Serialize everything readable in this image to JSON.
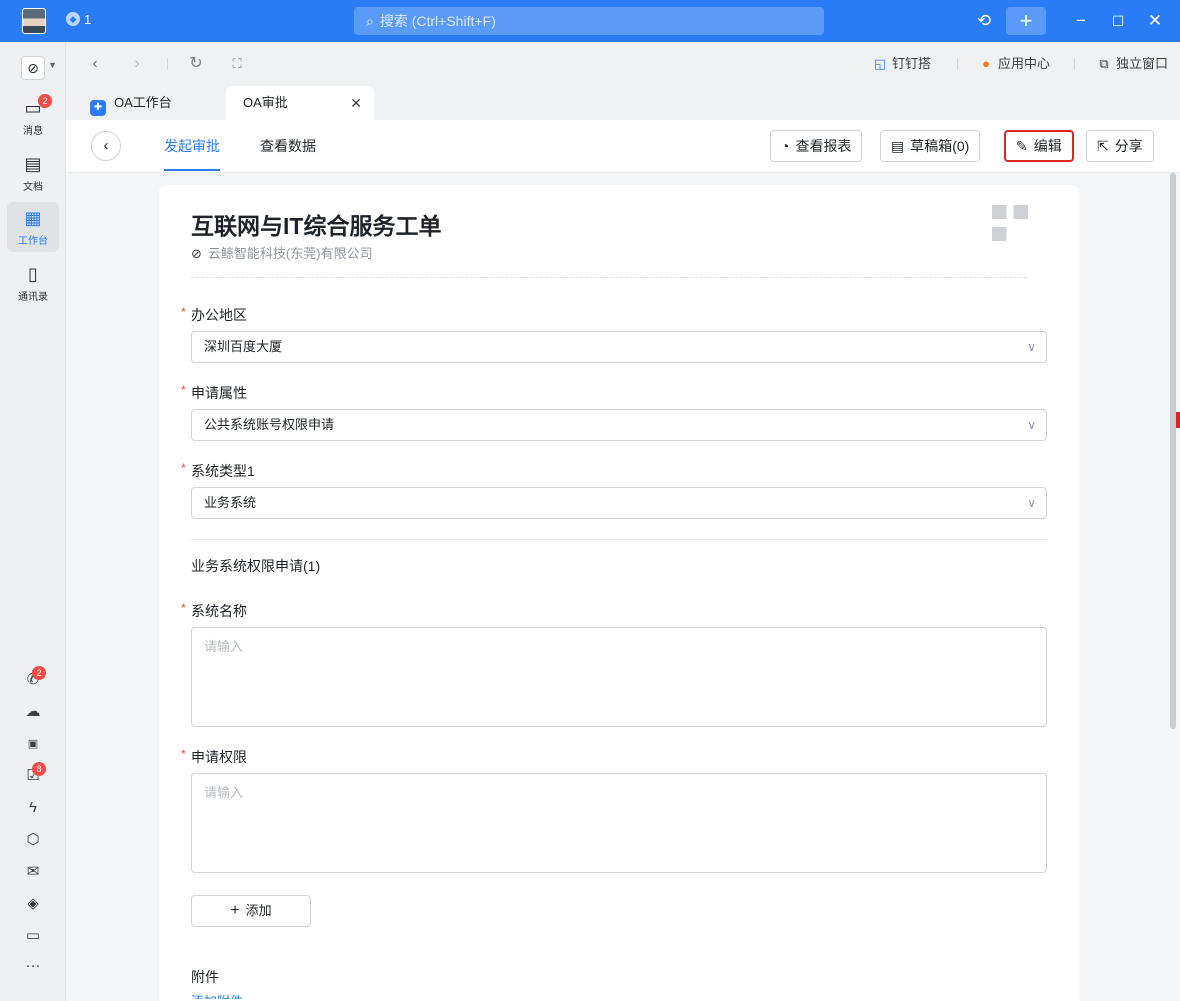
{
  "titlebar": {
    "count": "1",
    "search_placeholder": "搜索 (Ctrl+Shift+F)"
  },
  "nav": {
    "items": [
      {
        "label": "消息",
        "badge": "2"
      },
      {
        "label": "文档"
      },
      {
        "label": "工作台"
      },
      {
        "label": "通讯录"
      }
    ],
    "tool_badges": {
      "calls": "2",
      "todo": "8"
    }
  },
  "browserbar": {
    "links": [
      "钉钉搭",
      "应用中心",
      "独立窗口"
    ]
  },
  "tabs": [
    {
      "label": "OA工作台"
    },
    {
      "label": "OA审批"
    }
  ],
  "header": {
    "tabs": [
      "发起审批",
      "查看数据"
    ],
    "buttons": {
      "report": "查看报表",
      "drafts": "草稿箱(0)",
      "edit": "编辑",
      "share": "分享"
    }
  },
  "form": {
    "title": "互联网与IT综合服务工单",
    "company": "云鲸智能科技(东莞)有限公司",
    "fields": {
      "office": {
        "label": "办公地区",
        "value": "深圳百度大厦"
      },
      "apply_attr": {
        "label": "申请属性",
        "value": "公共系统账号权限申请"
      },
      "sys_type": {
        "label": "系统类型1",
        "value": "业务系统"
      },
      "section": "业务系统权限申请(1)",
      "sys_name": {
        "label": "系统名称",
        "placeholder": "请输入"
      },
      "permission": {
        "label": "申请权限",
        "placeholder": "请输入"
      },
      "add": "添加",
      "attachment": {
        "label": "附件",
        "link": "添加附件"
      }
    }
  },
  "colors": {
    "brand": "#2a7cf6",
    "badge": "#f54a45",
    "highlight": "#e02424"
  }
}
